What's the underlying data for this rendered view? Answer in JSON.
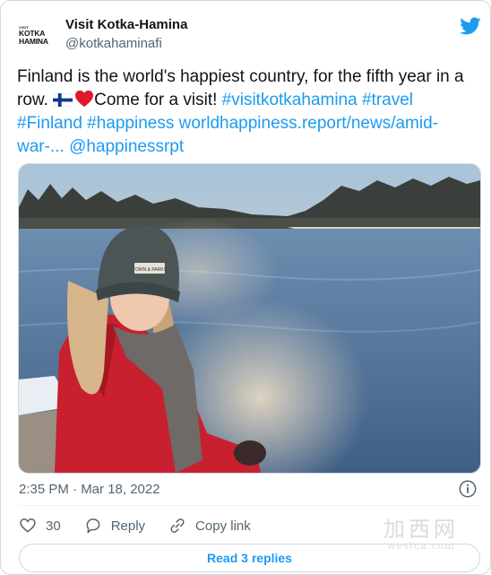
{
  "account": {
    "display_name": "Visit Kotka-Hamina",
    "handle": "@kotkahaminafi",
    "avatar_text_small": "VISIT",
    "avatar_text_line1": "KOTKA",
    "avatar_text_line2": "HAMINA",
    "avatar_icon": "kotka-hamina-logo"
  },
  "platform_icon": "twitter-bird-icon",
  "tweet": {
    "text_part1": "Finland is the world's happiest country, for the fifth year in a row. ",
    "emoji_1": "finland-flag-emoji",
    "emoji_2": "red-heart-emoji",
    "text_part2": "Come for a visit! ",
    "hashtags_1": "#visitkotkahamina #travel",
    "hashtags_2": "#Finland #happiness",
    "link": "worldhappiness.report/news/amid-war-...",
    "mention": "@happinessrpt"
  },
  "media": {
    "cap_label": "TOWN & PARKS"
  },
  "timestamp": "2:35 PM · Mar 18, 2022",
  "actions": {
    "likes_count": "30",
    "reply_label": "Reply",
    "copy_link_label": "Copy link"
  },
  "read_replies_label": "Read 3 replies",
  "watermark": {
    "main": "加西网",
    "sub": "westca.com"
  },
  "colors": {
    "accent": "#1d9bf0",
    "text": "#0f1419",
    "muted": "#536471",
    "border": "#cfd9de"
  }
}
